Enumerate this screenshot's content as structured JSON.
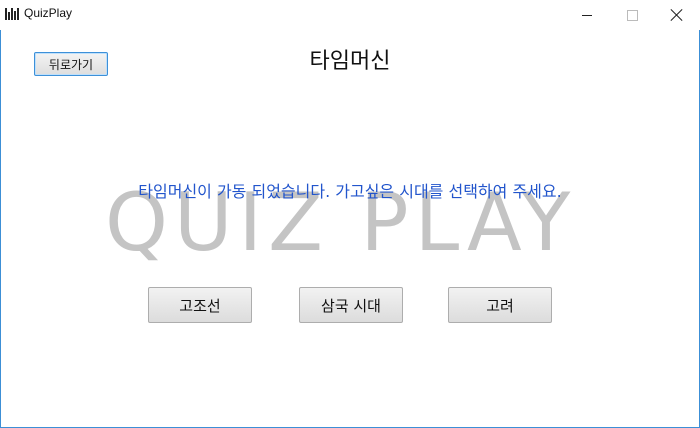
{
  "window": {
    "title": "QuizPlay",
    "icon": "app-logo-icon",
    "controls": [
      "minimize-icon",
      "maximize-icon",
      "close-icon"
    ]
  },
  "header": {
    "back_label": "뒤로가기",
    "title": "타임머신"
  },
  "main": {
    "watermark": "QUIZ PLAY",
    "message": "타임머신이 가동 되었습니다. 가고싶은 시대를 선택하여 주세요.",
    "eras": [
      "고조선",
      "삼국 시대",
      "고려"
    ]
  },
  "colors": {
    "message_text": "#2255cc",
    "watermark": "#c4c4c4",
    "focus_border": "#3d90d8"
  }
}
